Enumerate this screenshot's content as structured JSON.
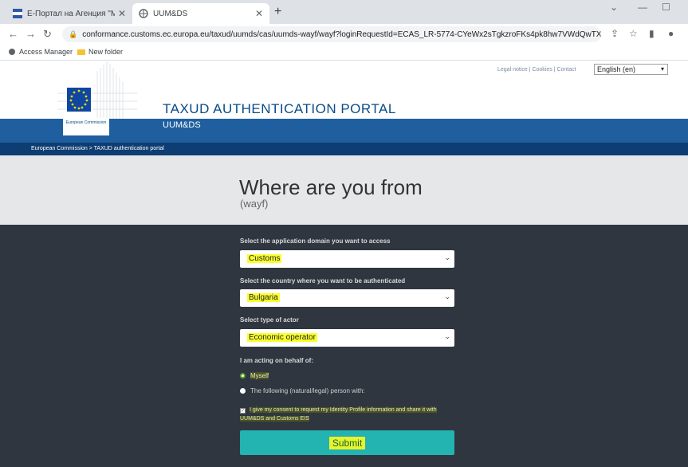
{
  "browser": {
    "tabs": [
      {
        "title": "Е-Портал на Агенция \"Митници\"",
        "active": false
      },
      {
        "title": "UUM&DS",
        "active": true
      }
    ],
    "url": "conformance.customs.ec.europa.eu/taxud/uumds/cas/uumds-wayf/wayf?loginRequestId=ECAS_LR-5774-CYeWx2sTgkzroFKs4pk8hw7VWdQwTX8reSZYBH...",
    "bookmarks": [
      "Access Manager",
      "New folder"
    ]
  },
  "header": {
    "portal_title": "TAXUD AUTHENTICATION PORTAL",
    "toplinks": "Legal notice | Cookies | Contact",
    "language": "English (en)",
    "app_name": "UUM&DS",
    "ec_label": "European Commission",
    "breadcrumb": "European Commission > TAXUD authentication portal"
  },
  "wayf": {
    "title": "Where are you from",
    "subtitle": "(wayf)"
  },
  "form": {
    "domain_label": "Select the application domain you want to access",
    "domain_value": "Customs",
    "country_label": "Select the country where you want to be authenticated",
    "country_value": "Bulgaria",
    "actor_label": "Select type of actor",
    "actor_value": "Economic operator",
    "behalf_label": "I am acting on behalf of:",
    "opt_myself": "Myself",
    "opt_other": "The following (natural/legal) person with:",
    "consent": "I give my consent to request my Identity Profile information and share it with UUM&DS and Customs EIS",
    "submit": "Submit"
  }
}
